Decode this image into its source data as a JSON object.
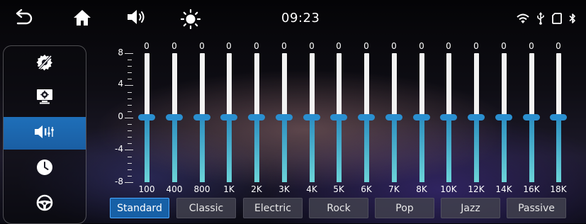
{
  "status": {
    "time": "09:23",
    "left_icons": [
      "back-icon",
      "home-icon",
      "volume-icon",
      "brightness-icon"
    ],
    "right_icons": [
      "wifi-icon",
      "usb-icon",
      "sd-card-icon",
      "bluetooth-icon"
    ]
  },
  "sidebar": {
    "items": [
      {
        "name": "settings-gear-icon",
        "active": false
      },
      {
        "name": "display-settings-icon",
        "active": false
      },
      {
        "name": "sound-equalizer-icon",
        "active": true
      },
      {
        "name": "clock-icon",
        "active": false
      },
      {
        "name": "steering-wheel-icon",
        "active": false
      }
    ]
  },
  "equalizer": {
    "y_ticks": [
      "8",
      "4",
      "0",
      "-4",
      "-8"
    ],
    "bands": [
      {
        "freq": "100",
        "value": "0"
      },
      {
        "freq": "400",
        "value": "0"
      },
      {
        "freq": "800",
        "value": "0"
      },
      {
        "freq": "1K",
        "value": "0"
      },
      {
        "freq": "2K",
        "value": "0"
      },
      {
        "freq": "3K",
        "value": "0"
      },
      {
        "freq": "4K",
        "value": "0"
      },
      {
        "freq": "5K",
        "value": "0"
      },
      {
        "freq": "6K",
        "value": "0"
      },
      {
        "freq": "7K",
        "value": "0"
      },
      {
        "freq": "8K",
        "value": "0"
      },
      {
        "freq": "10K",
        "value": "0"
      },
      {
        "freq": "12K",
        "value": "0"
      },
      {
        "freq": "14K",
        "value": "0"
      },
      {
        "freq": "16K",
        "value": "0"
      },
      {
        "freq": "18K",
        "value": "0"
      }
    ]
  },
  "presets": [
    {
      "label": "Standard",
      "active": true
    },
    {
      "label": "Classic",
      "active": false
    },
    {
      "label": "Electric",
      "active": false
    },
    {
      "label": "Rock",
      "active": false
    },
    {
      "label": "Pop",
      "active": false
    },
    {
      "label": "Jazz",
      "active": false
    },
    {
      "label": "Passive",
      "active": false
    }
  ],
  "colors": {
    "accent": "#1e6fb9",
    "slider_fill": "#3aa6c8",
    "knob": "#2a8fd0"
  }
}
